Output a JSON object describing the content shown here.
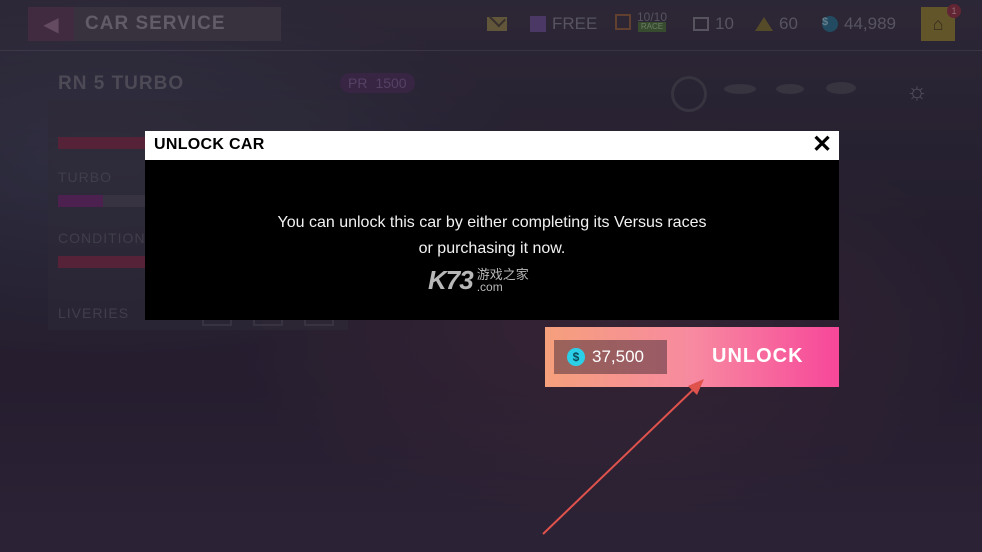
{
  "header": {
    "back_icon": "back-arrow-icon",
    "title": "CAR SERVICE",
    "free_label": "FREE",
    "daily": {
      "value": "10/10",
      "sub": "RACE"
    },
    "tickets": "10",
    "gold": "60",
    "coins": "44,989",
    "shop_badge": "1"
  },
  "car": {
    "name": "RN 5 TURBO",
    "pr_label": "PR",
    "pr_value": "1500"
  },
  "left_panel": {
    "turbo_label": "TURBO",
    "condition_label": "CONDITION",
    "liveries_label": "LIVERIES"
  },
  "modal": {
    "title": "UNLOCK CAR",
    "close_icon": "close-icon",
    "message_line1": "You can unlock this car by either completing its Versus races",
    "message_line2": "or purchasing it now.",
    "watermark_main": "K73",
    "watermark_cn": "游戏之家",
    "watermark_domain": ".com"
  },
  "unlock": {
    "price": "37,500",
    "label": "UNLOCK",
    "coin_icon": "coin-icon"
  },
  "colors": {
    "unlock_gradient_start": "#f6a07c",
    "unlock_gradient_end": "#f7479a",
    "coin": "#2bd0e8",
    "annotation_arrow": "#e0524c"
  }
}
